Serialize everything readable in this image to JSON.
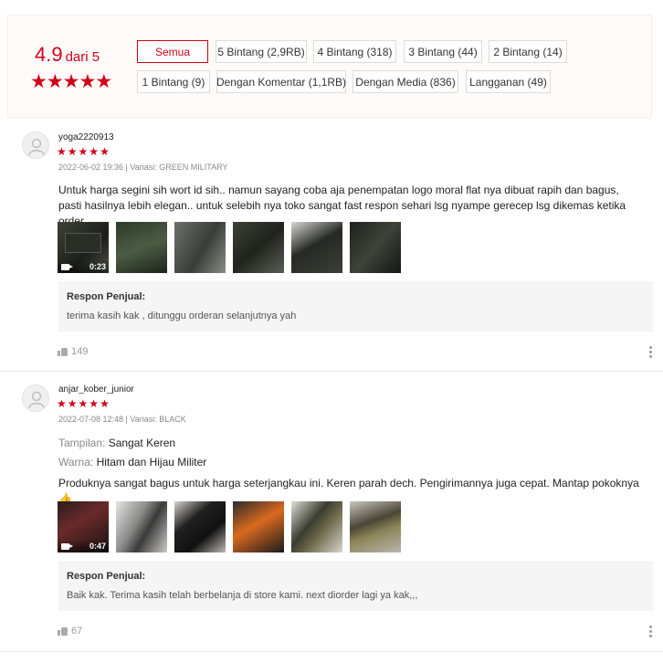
{
  "summary": {
    "score": "4.9",
    "out_of": "dari 5",
    "filters": [
      "Semua",
      "5 Bintang (2,9RB)",
      "4 Bintang (318)",
      "3 Bintang (44)",
      "2 Bintang (14)",
      "1 Bintang (9)",
      "Dengan Komentar (1,1RB)",
      "Dengan Media (836)",
      "Langganan (49)"
    ],
    "active_filter": "Semua"
  },
  "reviews": [
    {
      "username": "yoga2220913",
      "rating": 5,
      "meta": "2022-06-02 19:36 | Variasi: GREEN MILITARY",
      "comment": "Untuk harga segini sih wort id sih.. namun sayang coba aja penempatan logo moral flat nya dibuat rapih dan bagus, pasti hasilnya lebih elegan.. untuk selebih nya toko sangat fast respon sehari lsg nyampe gerecep lsg dikemas ketika order.",
      "video_duration": "0:23",
      "media": [
        "video",
        "photo",
        "photo",
        "photo",
        "photo",
        "photo"
      ],
      "seller_title": "Respon Penjual:",
      "seller_reply": "terima kasih kak , ditunggu orderan selanjutnya yah",
      "likes": "149"
    },
    {
      "username": "anjar_kober_junior",
      "rating": 5,
      "meta": "2022-07-08 12:48 | Variasi: BLACK",
      "attr1_key": "Tampilan:",
      "attr1_val": "Sangat Keren",
      "attr2_key": "Warna:",
      "attr2_val": "Hitam dan Hijau Militer",
      "comment": "Produknya sangat bagus untuk harga seterjangkau ini. Keren parah dech. Pengirimannya juga cepat. Mantap pokoknya 👍",
      "video_duration": "0:47",
      "media": [
        "video",
        "photo",
        "photo",
        "photo",
        "photo",
        "photo"
      ],
      "seller_title": "Respon Penjual:",
      "seller_reply": "Baik kak. Terima kasih telah berbelanja di store kami. next diorder lagi ya kak,,,",
      "likes": "67"
    }
  ],
  "colors": {
    "accent": "#d0011b",
    "summary_bg": "#fffbf8"
  },
  "icons": [
    "star-icon",
    "avatar-icon",
    "video-camera-icon",
    "thumbs-up-icon",
    "more-options-icon"
  ]
}
